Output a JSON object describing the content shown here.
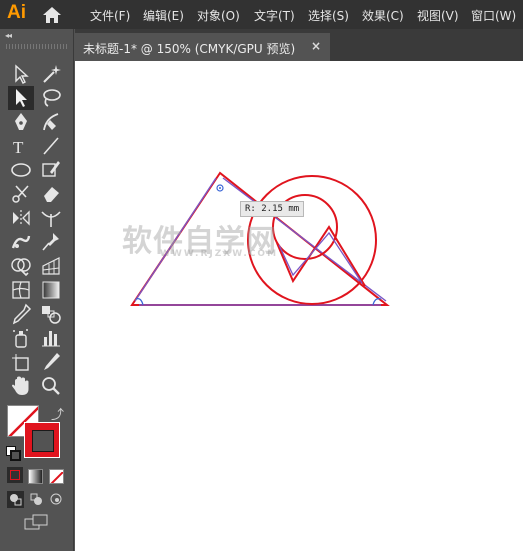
{
  "app": {
    "logo": "Ai"
  },
  "menu": [
    "文件(F)",
    "编辑(E)",
    "对象(O)",
    "文字(T)",
    "选择(S)",
    "效果(C)",
    "视图(V)",
    "窗口(W)"
  ],
  "document_tab": {
    "title": "未标题-1* @ 150% (CMYK/GPU 预览)",
    "close": "×"
  },
  "tooltip": {
    "text": "R: 2.15 mm"
  },
  "watermark": {
    "main": "软件自学网",
    "sub": "WWW.RJZXW.COM"
  },
  "colors": {
    "accent": "#ff9a00",
    "stroke_red": "#e0141e",
    "path_purple": "#7b56c4",
    "canvas": "#ffffff",
    "ui_dark": "#323232",
    "ui_mid": "#535353"
  },
  "tools": [
    "direct-selection-tool",
    "magic-wand-tool",
    "selection-tool",
    "lasso-tool",
    "pen-tool",
    "curvature-tool",
    "type-tool",
    "line-segment-tool",
    "ellipse-tool",
    "paintbrush-tool",
    "scissors-tool",
    "eraser-tool",
    "reflect-tool",
    "width-tool",
    "puppet-warp-tool",
    "pin-tool",
    "shape-builder-tool",
    "perspective-grid-tool",
    "mesh-tool",
    "gradient-tool",
    "eyedropper-tool",
    "blend-tool",
    "symbol-sprayer-tool",
    "column-graph-tool",
    "artboard-tool",
    "slice-tool",
    "hand-tool",
    "zoom-tool"
  ]
}
